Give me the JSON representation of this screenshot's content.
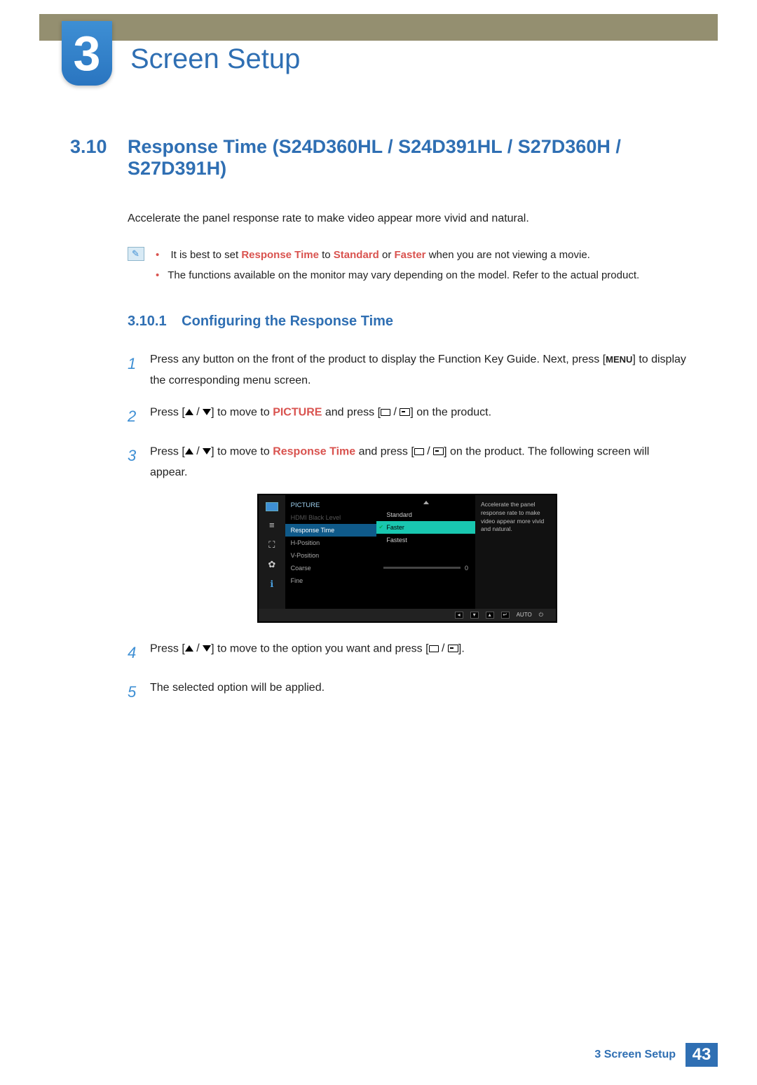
{
  "chapter": {
    "number": "3",
    "title": "Screen Setup"
  },
  "section": {
    "number": "3.10",
    "title": "Response Time (S24D360HL / S24D391HL / S27D360H / S27D391H)"
  },
  "intro_text": "Accelerate the panel response rate to make video appear more vivid and natural.",
  "notes": {
    "item1_prefix": "It is best to set ",
    "item1_kw1": "Response Time",
    "item1_mid1": " to ",
    "item1_kw2": "Standard",
    "item1_mid2": " or ",
    "item1_kw3": "Faster",
    "item1_suffix": " when you are not viewing a movie.",
    "item2": "The functions available on the monitor may vary depending on the model. Refer to the actual product."
  },
  "subsection": {
    "number": "3.10.1",
    "title": "Configuring the Response Time"
  },
  "steps": {
    "s1_a": "Press any button on the front of the product to display the Function Key Guide. Next, press [",
    "s1_menu": "MENU",
    "s1_b": "] to display the corresponding menu screen.",
    "s2_a": "Press [",
    "s2_b": "] to move to ",
    "s2_kw": "PICTURE",
    "s2_c": " and press [",
    "s2_d": "] on the product.",
    "s3_a": "Press [",
    "s3_b": "] to move to ",
    "s3_kw": "Response Time",
    "s3_c": " and press [",
    "s3_d": "] on the product. The following screen will appear.",
    "s4_a": "Press [",
    "s4_b": "] to move to the option you want and press [",
    "s4_c": "].",
    "s5": "The selected option will be applied."
  },
  "step_numbers": {
    "n1": "1",
    "n2": "2",
    "n3": "3",
    "n4": "4",
    "n5": "5"
  },
  "osd": {
    "category": "PICTURE",
    "menu": {
      "hdmi": "HDMI Black Level",
      "response": "Response Time",
      "hpos": "H-Position",
      "vpos": "V-Position",
      "coarse": "Coarse",
      "fine": "Fine"
    },
    "options": {
      "standard": "Standard",
      "faster": "Faster",
      "fastest": "Fastest"
    },
    "fine_value": "0",
    "description": "Accelerate the panel response rate to make video appear more vivid and natural.",
    "footer_auto": "AUTO"
  },
  "footer": {
    "text": "3 Screen Setup",
    "page": "43"
  }
}
